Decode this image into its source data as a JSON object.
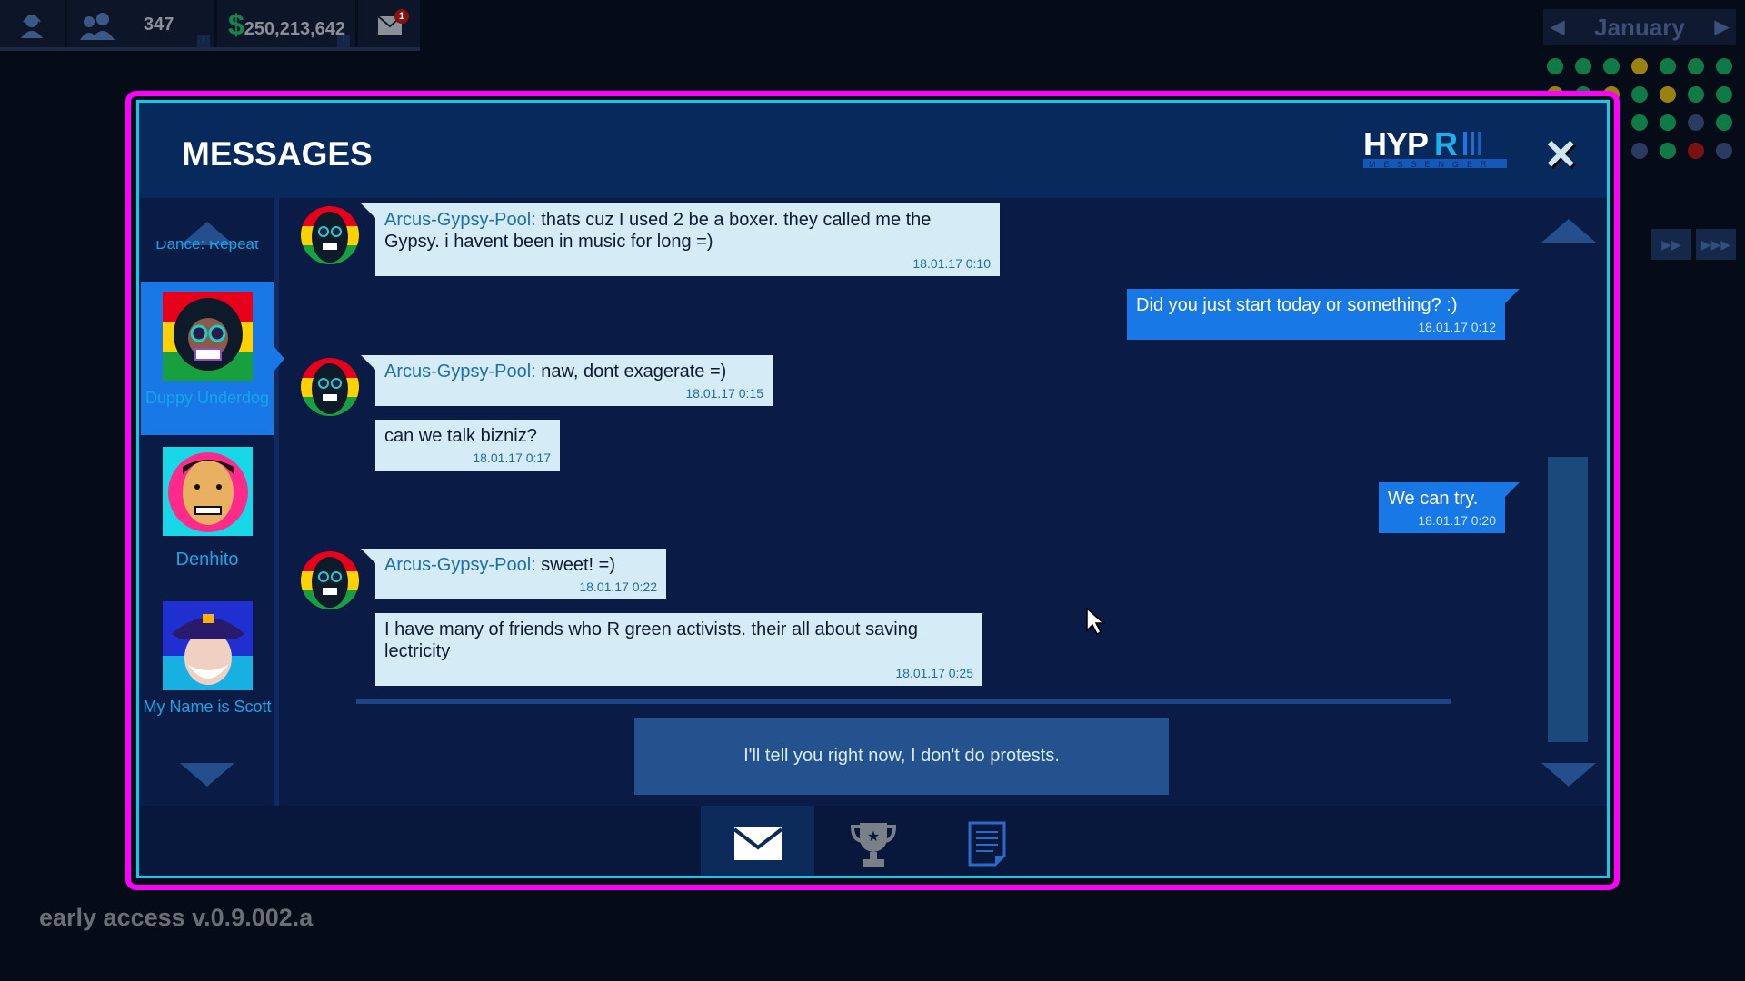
{
  "topbar": {
    "staff_count": "347",
    "money": "$250,213,642",
    "money_amount": "250,213,642",
    "mail_badge": "1"
  },
  "calendar": {
    "month": "January"
  },
  "window": {
    "title": "MESSAGES",
    "logo_text": "HYPR",
    "logo_sub": "MESSENGER",
    "close": "✕"
  },
  "sidebar": {
    "clipped_item": "Dance: Repeat",
    "contacts": [
      {
        "name": "Duppy Underdog",
        "active": true
      },
      {
        "name": "Denhito",
        "active": false
      },
      {
        "name": "My Name is Scott",
        "active": false
      }
    ]
  },
  "messages": [
    {
      "from": "Arcus-Gypsy-Pool:",
      "text": "thats cuz I used 2 be a boxer. they called me the Gypsy. i havent been in music for long =)",
      "time": "18.01.17 0:10",
      "side": "them"
    },
    {
      "from": "",
      "text": "Did you just start today or something? :)",
      "time": "18.01.17 0:12",
      "side": "me"
    },
    {
      "from": "Arcus-Gypsy-Pool:",
      "text": "naw, dont exagerate =)",
      "time": "18.01.17 0:15",
      "side": "them"
    },
    {
      "from": "",
      "text": "can we talk bizniz?",
      "time": "18.01.17 0:17",
      "side": "them"
    },
    {
      "from": "",
      "text": "We can try.",
      "time": "18.01.17 0:20",
      "side": "me"
    },
    {
      "from": "Arcus-Gypsy-Pool:",
      "text": "sweet! =)",
      "time": "18.01.17 0:22",
      "side": "them"
    },
    {
      "from": "",
      "text": "I have many of friends who R green activists. their all about saving lectricity",
      "time": "18.01.17 0:25",
      "side": "them"
    }
  ],
  "reply_option": "I'll tell you right now, I don't do protests.",
  "footer_tabs": [
    {
      "icon": "mail-icon",
      "active": true
    },
    {
      "icon": "trophy-icon",
      "active": false
    },
    {
      "icon": "document-icon",
      "active": false
    }
  ],
  "version": "early access v.0.9.002.a",
  "colors": {
    "frame": "#ff00ff",
    "inner_border": "#11c8ee",
    "active_contact": "#1778e6",
    "my_bubble": "#1778e6",
    "their_bubble": "#d5ebf5"
  }
}
